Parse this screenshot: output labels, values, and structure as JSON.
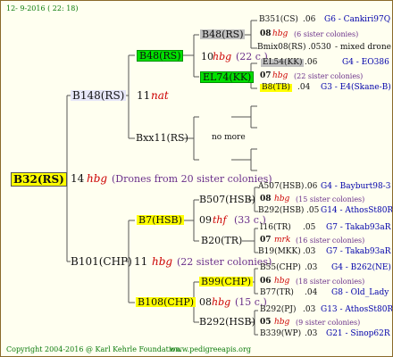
{
  "header": {
    "date": "12- 9-2016 ( 22: 18)"
  },
  "root": {
    "label": "B32(RS)",
    "gen_num": "14",
    "gen_label": "hbg",
    "note": "(Drones from 20 sister colonies)"
  },
  "sire": {
    "label": "B148(RS)",
    "gen_num": "11",
    "gen_label": "nat"
  },
  "b48": {
    "label": "B48(RS)"
  },
  "b48_sire": {
    "label": "B48(RS)",
    "gen_num": "10",
    "gen_label": "hbg",
    "note": "(22 c.)"
  },
  "b48_sire_sire": {
    "label": "B351(CS)",
    "num": ".06",
    "code": "G6 - Cankiri97Q"
  },
  "b48_sire_gen": {
    "num": "08",
    "label": "hbg",
    "note": "(6 sister colonies)"
  },
  "b48_sire_dam": {
    "label": "Bmix08(RS)",
    "num": ".0530",
    "code": "- mixed drone"
  },
  "el74": {
    "label": "EL74(KK)"
  },
  "el74_sire": {
    "label": "EL54(KK)",
    "num": ".06",
    "code": "G4 - EO386"
  },
  "el74_gen": {
    "num": "07",
    "label": "hbg",
    "note": "(22 sister colonies)"
  },
  "el74_dam": {
    "label": "B8(TB)",
    "num": ".04",
    "code": "G3 - E4(Skane-B)"
  },
  "bxx11": {
    "label": "Bxx11(RS)",
    "note": "no more"
  },
  "dam": {
    "label": "B101(CHP)",
    "gen_num": "11",
    "gen_label": "hbg",
    "note": "(22 sister colonies)"
  },
  "b7": {
    "label": "B7(HSB)",
    "gen_num": "09",
    "gen_label": "thf",
    "note": "(33 c.)"
  },
  "b507": {
    "label": "B507(HSB)"
  },
  "a507": {
    "label": "A507(HSB)",
    "num": ".06",
    "code": "G4 - Bayburt98-3"
  },
  "b507_gen": {
    "num": "08",
    "label": "hbg",
    "note": "(15 sister colonies)"
  },
  "b292a": {
    "label": "B292(HSB)",
    "num": ".05",
    "code": "G14 - AthosSt80R"
  },
  "b20": {
    "label": "B20(TR)"
  },
  "i16": {
    "label": "I16(TR)",
    "num": ".05",
    "code": "G7 - Takab93aR"
  },
  "b20_gen": {
    "num": "07",
    "label": "mrk",
    "note": "(16 sister colonies)"
  },
  "b19": {
    "label": "B19(MKK)",
    "num": ".03",
    "code": "G7 - Takab93aR"
  },
  "b108": {
    "label": "B108(CHP)",
    "gen_num": "08",
    "gen_label": "hbg",
    "note": "(15 c.)"
  },
  "b99": {
    "label": "B99(CHP)"
  },
  "b55": {
    "label": "B55(CHP)",
    "num": ".03",
    "code": "G4 - B262(NE)"
  },
  "b99_gen": {
    "num": "06",
    "label": "hbg",
    "note": "(18 sister colonies)"
  },
  "b77": {
    "label": "B77(TR)",
    "num": ".04",
    "code": "G8 - Old_Lady"
  },
  "b292b": {
    "label": "B292(HSB)"
  },
  "b292pj": {
    "label": "B292(PJ)",
    "num": ".03",
    "code": "G13 - AthosSt80R"
  },
  "b292_gen": {
    "num": "05",
    "label": "hbg",
    "note": "(9 sister colonies)"
  },
  "b339": {
    "label": "B339(WP)",
    "num": ".03",
    "code": "G21 - Sinop62R"
  },
  "footer": {
    "copyright": "Copyright 2004-2016 @ Karl Kehrle Foundation.",
    "url": "www.pedigreeapis.org"
  }
}
